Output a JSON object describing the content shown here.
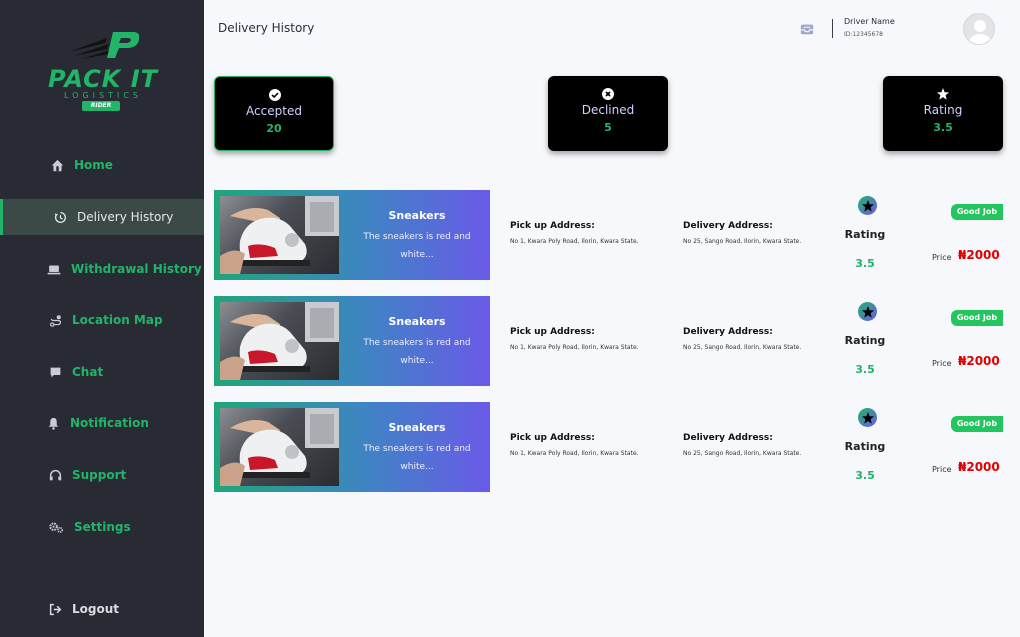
{
  "brand": {
    "name": "PACK IT",
    "sub": "LOGISTICS",
    "badge": "RIDER",
    "accent": "#22b469"
  },
  "sidebar": {
    "items": [
      {
        "label": "Home",
        "icon": "home-icon"
      },
      {
        "label": "Delivery History",
        "icon": "history-icon",
        "active": true
      },
      {
        "label": "Withdrawal History",
        "icon": "laptop-icon"
      },
      {
        "label": "Location Map",
        "icon": "route-icon"
      },
      {
        "label": "Chat",
        "icon": "chat-icon"
      },
      {
        "label": "Notification",
        "icon": "bell-icon"
      },
      {
        "label": "Support",
        "icon": "headset-icon"
      },
      {
        "label": "Settings",
        "icon": "gears-icon"
      }
    ],
    "logout": {
      "label": "Logout",
      "icon": "logout-icon"
    }
  },
  "header": {
    "title": "Delivery History",
    "driver_name": "Driver Name",
    "driver_id": "ID:12345678"
  },
  "stats": [
    {
      "label": "Accepted",
      "value": "20",
      "icon": "check-icon"
    },
    {
      "label": "Declined",
      "value": "5",
      "icon": "x-circle-icon"
    },
    {
      "label": "Rating",
      "value": "3.5",
      "icon": "star-icon"
    }
  ],
  "deliveries": [
    {
      "title": "Sneakers",
      "desc_line1": "The sneakers is red and",
      "desc_line2": "white...",
      "pickup_label": "Pick up Address:",
      "pickup": "No 1, Kwara Poly Road, Ilorin, Kwara State.",
      "delivery_label": "Delivery Address:",
      "delivery": "No 25, Sango Road, Ilorin, Kwara State.",
      "rating_label": "Rating",
      "rating": "3.5",
      "badge": "Good Job",
      "price_label": "Price",
      "price": "₦2000"
    },
    {
      "title": "Sneakers",
      "desc_line1": "The sneakers is red and",
      "desc_line2": "white...",
      "pickup_label": "Pick up Address:",
      "pickup": "No 1, Kwara Poly Road, Ilorin, Kwara State.",
      "delivery_label": "Delivery Address:",
      "delivery": "No 25, Sango Road, Ilorin, Kwara State.",
      "rating_label": "Rating",
      "rating": "3.5",
      "badge": "Good Job",
      "price_label": "Price",
      "price": "₦2000"
    },
    {
      "title": "Sneakers",
      "desc_line1": "The sneakers is red and",
      "desc_line2": "white...",
      "pickup_label": "Pick up Address:",
      "pickup": "No 1, Kwara Poly Road, Ilorin, Kwara State.",
      "delivery_label": "Delivery Address:",
      "delivery": "No 25, Sango Road, Ilorin, Kwara State.",
      "rating_label": "Rating",
      "rating": "3.5",
      "badge": "Good Job",
      "price_label": "Price",
      "price": "₦2000"
    }
  ]
}
